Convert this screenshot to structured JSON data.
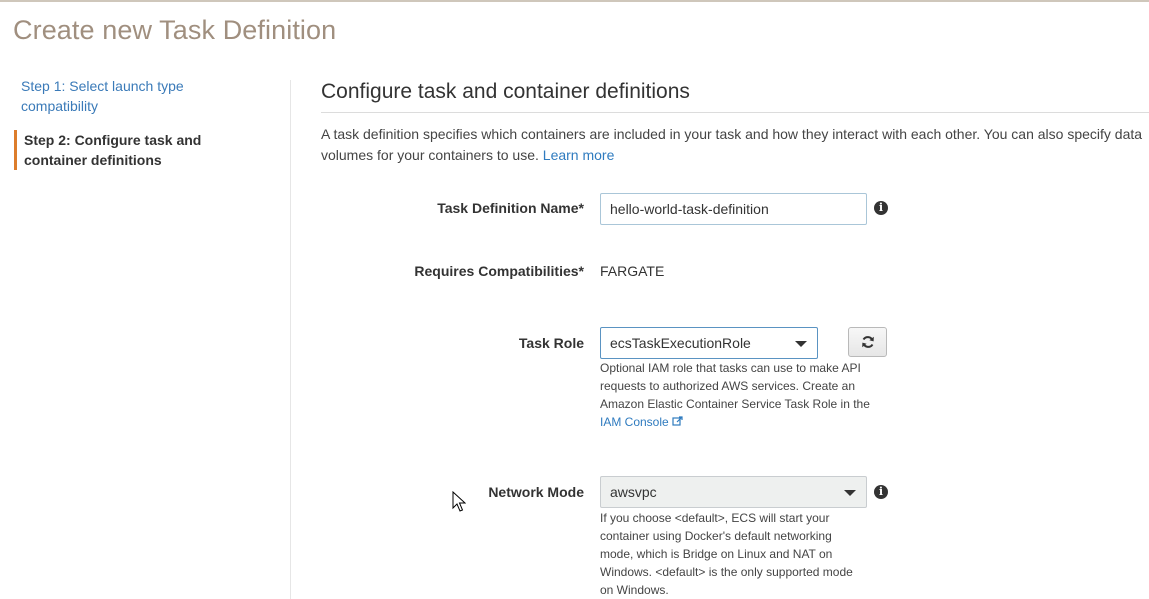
{
  "page": {
    "title": "Create new Task Definition"
  },
  "steps": [
    {
      "label": "Step 1: Select launch type compatibility",
      "active": false
    },
    {
      "label": "Step 2: Configure task and container definitions",
      "active": true
    }
  ],
  "section": {
    "title": "Configure task and container definitions",
    "description": "A task definition specifies which containers are included in your task and how they interact with each other. You can also specify data volumes for your containers to use.",
    "learn_more": "Learn more"
  },
  "fields": {
    "task_def_name": {
      "label": "Task Definition Name*",
      "value": "hello-world-task-definition"
    },
    "requires_compat": {
      "label": "Requires Compatibilities*",
      "value": "FARGATE"
    },
    "task_role": {
      "label": "Task Role",
      "value": "ecsTaskExecutionRole",
      "help": "Optional IAM role that tasks can use to make API requests to authorized AWS services. Create an Amazon Elastic Container Service Task Role in the",
      "help_link": "IAM Console"
    },
    "network_mode": {
      "label": "Network Mode",
      "value": "awsvpc",
      "help": "If you choose <default>, ECS will start your container using Docker's default networking mode, which is Bridge on Linux and NAT on Windows. <default> is the only supported mode on Windows."
    }
  },
  "icons": {
    "info": "info-icon",
    "refresh": "refresh-icon",
    "external": "external-link-icon",
    "dropdown": "chevron-down-icon"
  },
  "colors": {
    "accent_step": "#dd7d2b",
    "link": "#2f7bbf",
    "title": "#a08f7f"
  }
}
